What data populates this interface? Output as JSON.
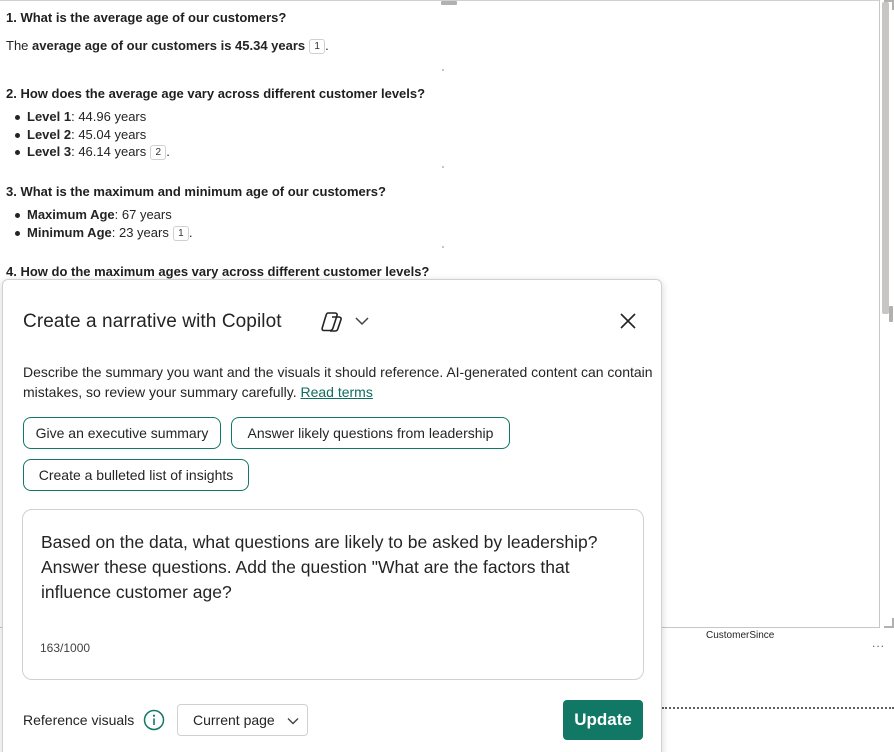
{
  "narrative": {
    "q1": "1. What is the average age of our customers?",
    "a1_prefix": "The ",
    "a1_bold": "average age of our customers is 45.34 years",
    "a1_cite": "1",
    "q2": "2. How does the average age vary across different customer levels?",
    "levels": [
      {
        "label": "Level 1",
        "value": ": 44.96 years",
        "cite": ""
      },
      {
        "label": "Level 2",
        "value": ": 45.04 years",
        "cite": ""
      },
      {
        "label": "Level 3",
        "value": ": 46.14 years",
        "cite": "2"
      }
    ],
    "q3": "3. What is the maximum and minimum age of our customers?",
    "extremes": [
      {
        "label": "Maximum Age",
        "value": ": 67 years",
        "cite": ""
      },
      {
        "label": "Minimum Age",
        "value": ": 23 years",
        "cite": "1"
      }
    ],
    "q4": "4. How do the maximum ages vary across different customer levels?"
  },
  "table": {
    "column_header": "CustomerSince",
    "more_label": "..."
  },
  "dialog": {
    "title": "Create a narrative with Copilot",
    "description": "Describe the summary you want and the visuals it should reference. AI-generated content can contain mistakes, so review your summary carefully.",
    "terms_link": "Read terms",
    "suggestions": [
      "Give an executive summary",
      "Answer likely questions from leadership",
      "Create a bulleted list of insights"
    ],
    "prompt_text": "Based on the data, what questions are likely to be asked by leadership? Answer these questions. Add the question \"What are the factors that influence customer age?",
    "char_count": "163/1000",
    "reference_label": "Reference visuals",
    "reference_selected": "Current page",
    "update_label": "Update"
  },
  "colors": {
    "accent": "#117865",
    "text": "#242424",
    "border": "#d1d1d1"
  }
}
